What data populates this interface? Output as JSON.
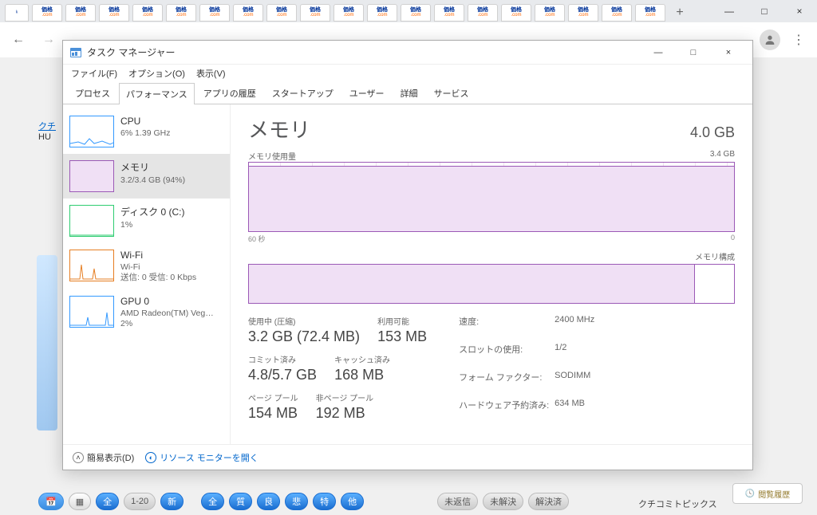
{
  "browser": {
    "tab_label_top": "価格",
    "tab_label_bottom": ".com",
    "new_tab": "+",
    "window": {
      "min": "—",
      "max": "□",
      "close": "×"
    }
  },
  "toolbar": {
    "back": "←",
    "forward": "→",
    "more": "⋮"
  },
  "tm_window": {
    "title": "タスク マネージャー",
    "win": {
      "min": "—",
      "max": "□",
      "close": "×"
    },
    "menus": [
      "ファイル(F)",
      "オプション(O)",
      "表示(V)"
    ],
    "tabs": [
      "プロセス",
      "パフォーマンス",
      "アプリの履歴",
      "スタートアップ",
      "ユーザー",
      "詳細",
      "サービス"
    ],
    "active_tab_index": 1
  },
  "sidebar": [
    {
      "name": "CPU",
      "sub": "6%  1.39 GHz",
      "color": "#3399ff"
    },
    {
      "name": "メモリ",
      "sub": "3.2/3.4 GB (94%)",
      "color": "#9b59b6"
    },
    {
      "name": "ディスク 0 (C:)",
      "sub": "1%",
      "color": "#2ecc71"
    },
    {
      "name": "Wi-Fi",
      "sub1": "Wi-Fi",
      "sub2": "送信: 0  受信: 0 Kbps",
      "color": "#e67e22"
    },
    {
      "name": "GPU 0",
      "sub1": "AMD Radeon(TM) Veg…",
      "sub2": "2%",
      "color": "#3399ff"
    }
  ],
  "main": {
    "title": "メモリ",
    "total": "4.0 GB",
    "graph1_label": "メモリ使用量",
    "graph1_max": "3.4 GB",
    "axis_left": "60 秒",
    "axis_right": "0",
    "graph2_label": "メモリ構成",
    "stats": {
      "in_use_label": "使用中 (圧縮)",
      "in_use_value": "3.2 GB (72.4 MB)",
      "avail_label": "利用可能",
      "avail_value": "153 MB",
      "commit_label": "コミット済み",
      "commit_value": "4.8/5.7 GB",
      "cached_label": "キャッシュ済み",
      "cached_value": "168 MB",
      "paged_label": "ページ プール",
      "paged_value": "154 MB",
      "nonpaged_label": "非ページ プール",
      "nonpaged_value": "192 MB"
    },
    "props": {
      "speed_l": "速度:",
      "speed_v": "2400 MHz",
      "slots_l": "スロットの使用:",
      "slots_v": "1/2",
      "form_l": "フォーム ファクター:",
      "form_v": "SODIMM",
      "hw_l": "ハードウェア予約済み:",
      "hw_v": "634 MB"
    }
  },
  "footer": {
    "fewer": "簡易表示(D)",
    "resmon": "リソース モニターを開く"
  },
  "bg": {
    "link1": "クチ",
    "text1": "HU",
    "buttons_blue": [
      "全"
    ],
    "buttons_char": [
      "新",
      "全",
      "質",
      "良",
      "悲",
      "特",
      "他"
    ],
    "buttons_gray": [
      "未返信",
      "未解決",
      "解決済"
    ],
    "history": "閲覧履歴",
    "topics": "クチコミトピックス"
  }
}
